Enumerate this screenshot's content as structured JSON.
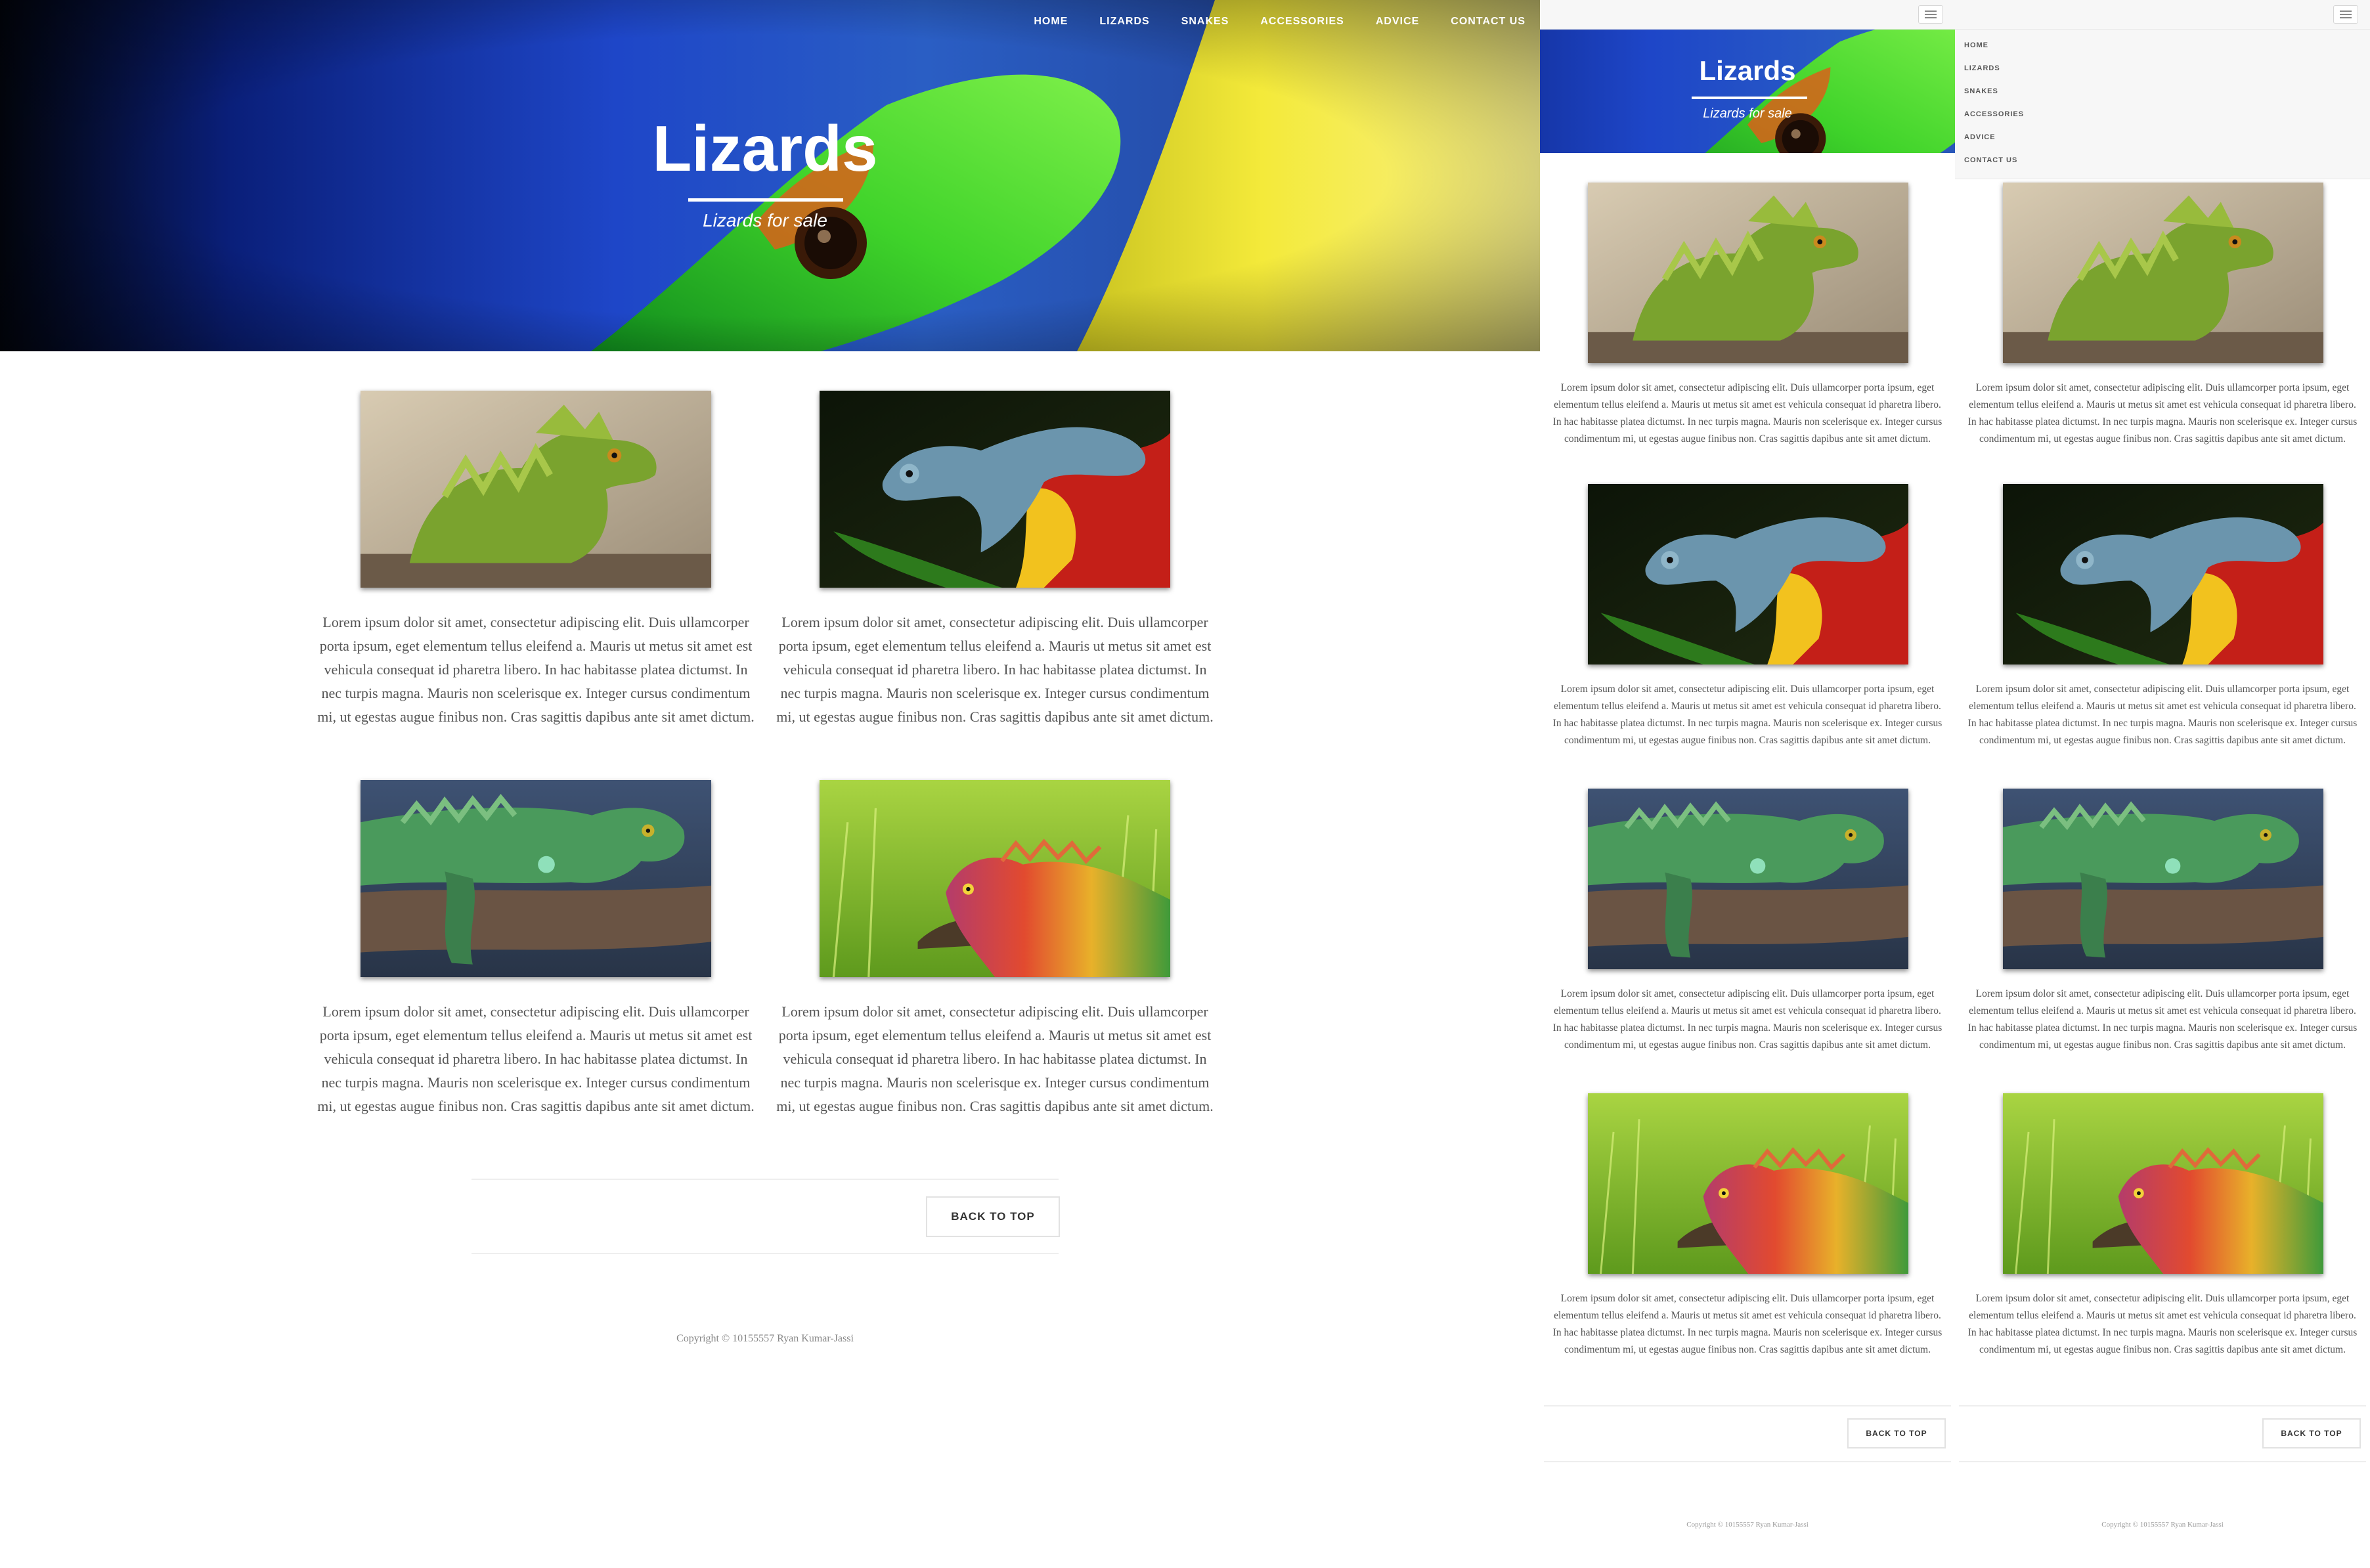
{
  "site": {
    "nav": [
      "HOME",
      "LIZARDS",
      "SNAKES",
      "ACCESSORIES",
      "ADVICE",
      "CONTACT US"
    ],
    "hero": {
      "title": "Lizards",
      "subtitle": "Lizards for sale"
    },
    "cards": [
      {
        "image": "basilisk-photo",
        "text": "Lorem ipsum dolor sit amet, consectetur adipiscing elit. Duis ullamcorper porta ipsum, eget elementum tellus eleifend a. Mauris ut metus sit amet est vehicula consequat id pharetra libero. In hac habitasse platea dictumst. In nec turpis magna. Mauris non scelerisque ex. Integer cursus condimentum mi, ut egestas augue finibus non. Cras sagittis dapibus ante sit amet dictum."
      },
      {
        "image": "chameleon-photo",
        "text": "Lorem ipsum dolor sit amet, consectetur adipiscing elit. Duis ullamcorper porta ipsum, eget elementum tellus eleifend a. Mauris ut metus sit amet est vehicula consequat id pharetra libero. In hac habitasse platea dictumst. In nec turpis magna. Mauris non scelerisque ex. Integer cursus condimentum mi, ut egestas augue finibus non. Cras sagittis dapibus ante sit amet dictum."
      },
      {
        "image": "iguana-photo",
        "text": "Lorem ipsum dolor sit amet, consectetur adipiscing elit. Duis ullamcorper porta ipsum, eget elementum tellus eleifend a. Mauris ut metus sit amet est vehicula consequat id pharetra libero. In hac habitasse platea dictumst. In nec turpis magna. Mauris non scelerisque ex. Integer cursus condimentum mi, ut egestas augue finibus non. Cras sagittis dapibus ante sit amet dictum."
      },
      {
        "image": "rainbow-iguana-photo",
        "text": "Lorem ipsum dolor sit amet, consectetur adipiscing elit. Duis ullamcorper porta ipsum, eget elementum tellus eleifend a. Mauris ut metus sit amet est vehicula consequat id pharetra libero. In hac habitasse platea dictumst. In nec turpis magna. Mauris non scelerisque ex. Integer cursus condimentum mi, ut egestas augue finibus non. Cras sagittis dapibus ante sit amet dictum."
      }
    ],
    "back_to_top": "BACK TO TOP",
    "copyright": "Copyright © 10155557 Ryan Kumar-Jassi",
    "menu_icon": "hamburger-icon",
    "colors": {
      "nav_text": "#ffffff",
      "body_text": "#555555",
      "divider": "#eeeeee",
      "mobile_bar": "#f7f7f7"
    }
  }
}
